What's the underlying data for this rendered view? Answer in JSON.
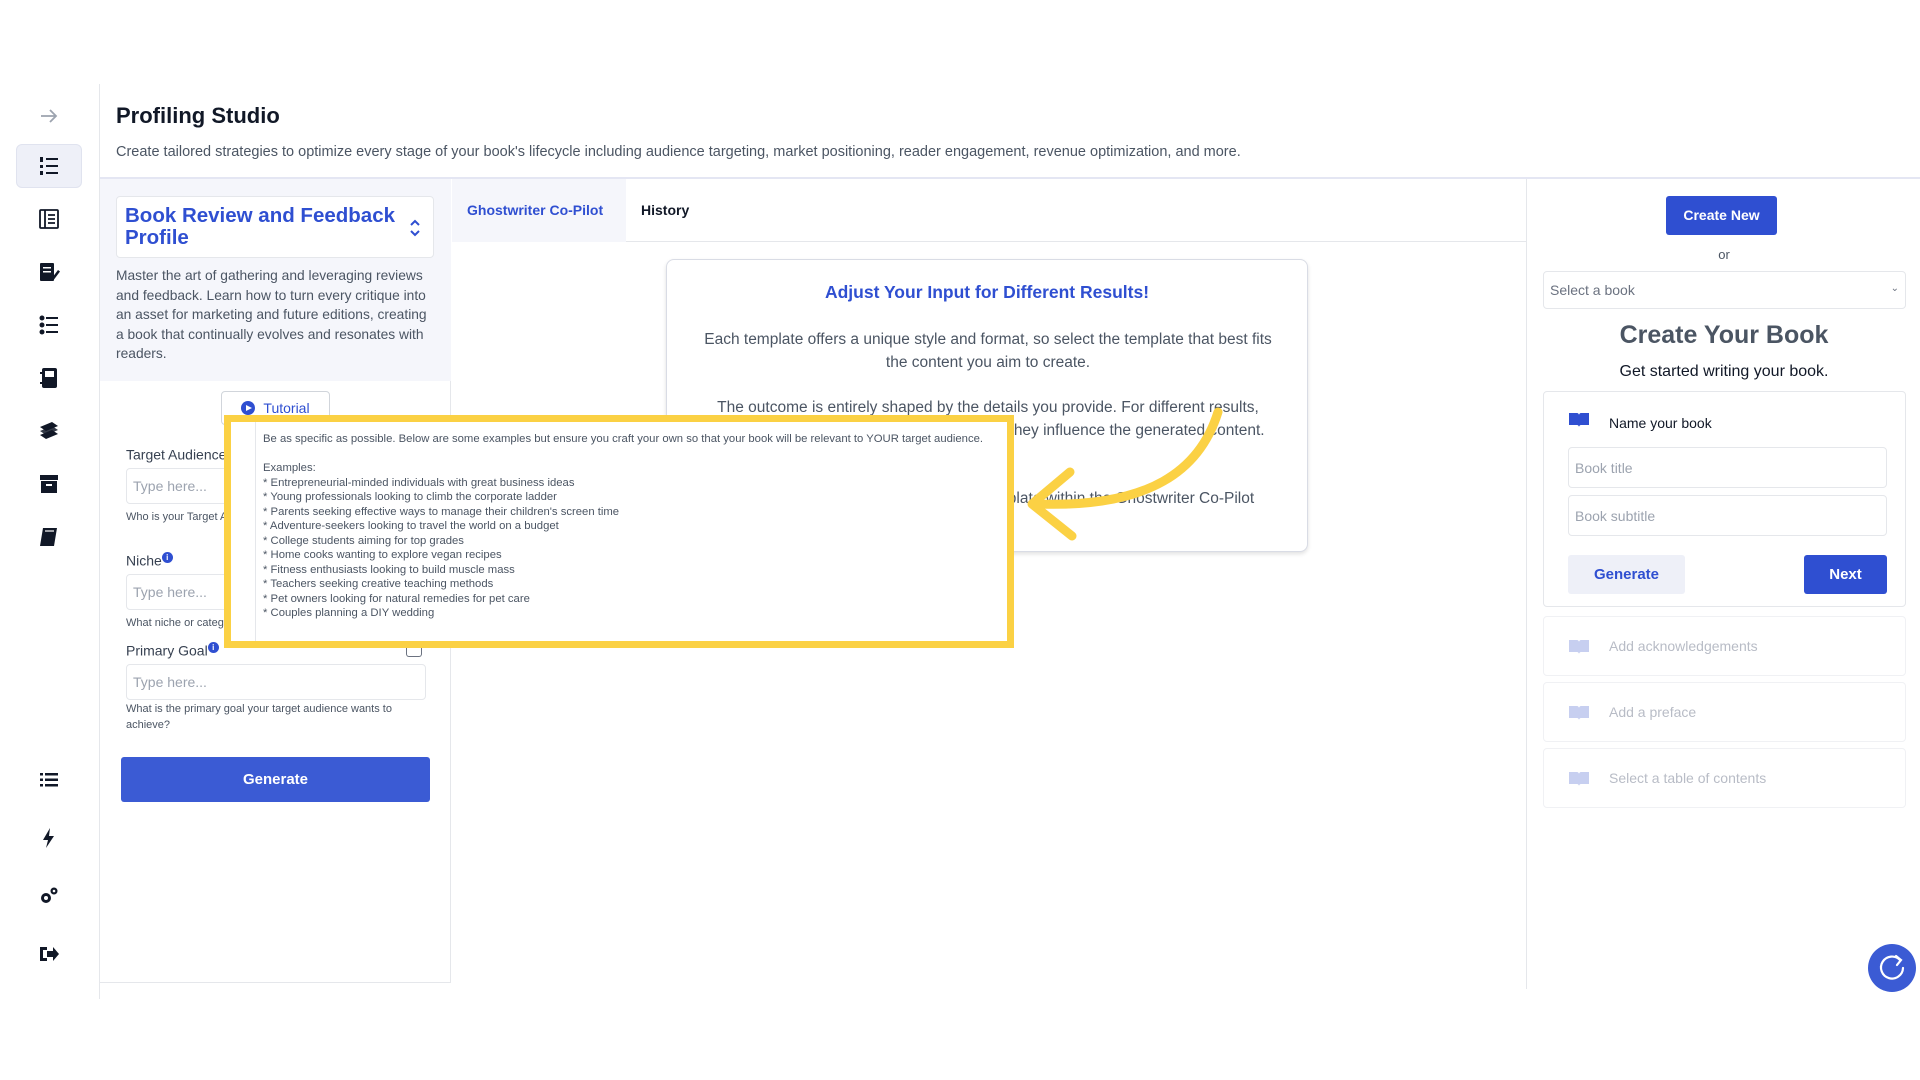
{
  "header": {
    "title": "Profiling Studio",
    "subtitle": "Create tailored strategies to optimize every stage of your book's lifecycle including audience targeting, market positioning, reader engagement, revenue optimization, and more."
  },
  "sidebar": {
    "icons": [
      "arrow-right-icon",
      "numbered-list-icon",
      "book-layout-icon",
      "edit-document-icon",
      "checklist-icon",
      "notebook-icon",
      "books-stack-icon",
      "archive-icon",
      "book-icon",
      "list-icon",
      "lightning-icon",
      "settings-icon",
      "logout-icon"
    ]
  },
  "profile": {
    "title": "Book Review and Feedback Profile",
    "description": "Master the art of gathering and leveraging reviews and feedback. Learn how to turn every critique into an asset for marketing and future editions, creating a book that continually evolves and resonates with readers.",
    "tutorial_label": "Tutorial"
  },
  "form": {
    "fields": [
      {
        "label": "Target Audience",
        "placeholder": "Type here...",
        "help": "Who is your Target Audience for this book for?"
      },
      {
        "label": "Niche",
        "placeholder": "Type here...",
        "help": "What niche or category does your book fall into?"
      },
      {
        "label": "Primary Goal",
        "placeholder": "Type here...",
        "help": "What is the primary goal your target audience wants to achieve?"
      }
    ],
    "generate_label": "Generate"
  },
  "tabs": {
    "copilot": "Ghostwriter Co-Pilot",
    "history": "History"
  },
  "info_card": {
    "title": "Adjust Your Input for Different Results!",
    "p1": "Each template offers a unique style and format, so select the template that best fits the content you aim to create.",
    "p2": "The outcome is entirely shaped by the details you provide. For different results, adjust or refine with your inputs to see how they influence the generated content.",
    "p3": "For more control, choose the Custom template within the Ghostwriter Co-Pilot section."
  },
  "tooltip": {
    "text": "Be as specific as possible. Below are some examples but ensure you craft your own so that your book will be relevant to YOUR target audience.\n\nExamples:\n* Entrepreneurial-minded individuals with great business ideas\n* Young professionals looking to climb the corporate ladder\n* Parents seeking effective ways to manage their children's screen time\n* Adventure-seekers looking to travel the world on a budget\n* College students aiming for top grades\n* Home cooks wanting to explore vegan recipes\n* Fitness enthusiasts looking to build muscle mass\n* Teachers seeking creative teaching methods\n* Pet owners looking for natural remedies for pet care\n* Couples planning a DIY wedding"
  },
  "right": {
    "create_new": "Create New",
    "or": "or",
    "select_placeholder": "Select a book",
    "title": "Create Your Book",
    "subtitle": "Get started writing your book.",
    "name_label": "Name your book",
    "title_placeholder": "Book title",
    "subtitle_placeholder": "Book subtitle",
    "generate": "Generate",
    "next": "Next",
    "steps": [
      "Add acknowledgements",
      "Add a preface",
      "Select a table of contents"
    ]
  },
  "colors": {
    "accent": "#2f4fd1",
    "highlight": "#fbd144"
  }
}
